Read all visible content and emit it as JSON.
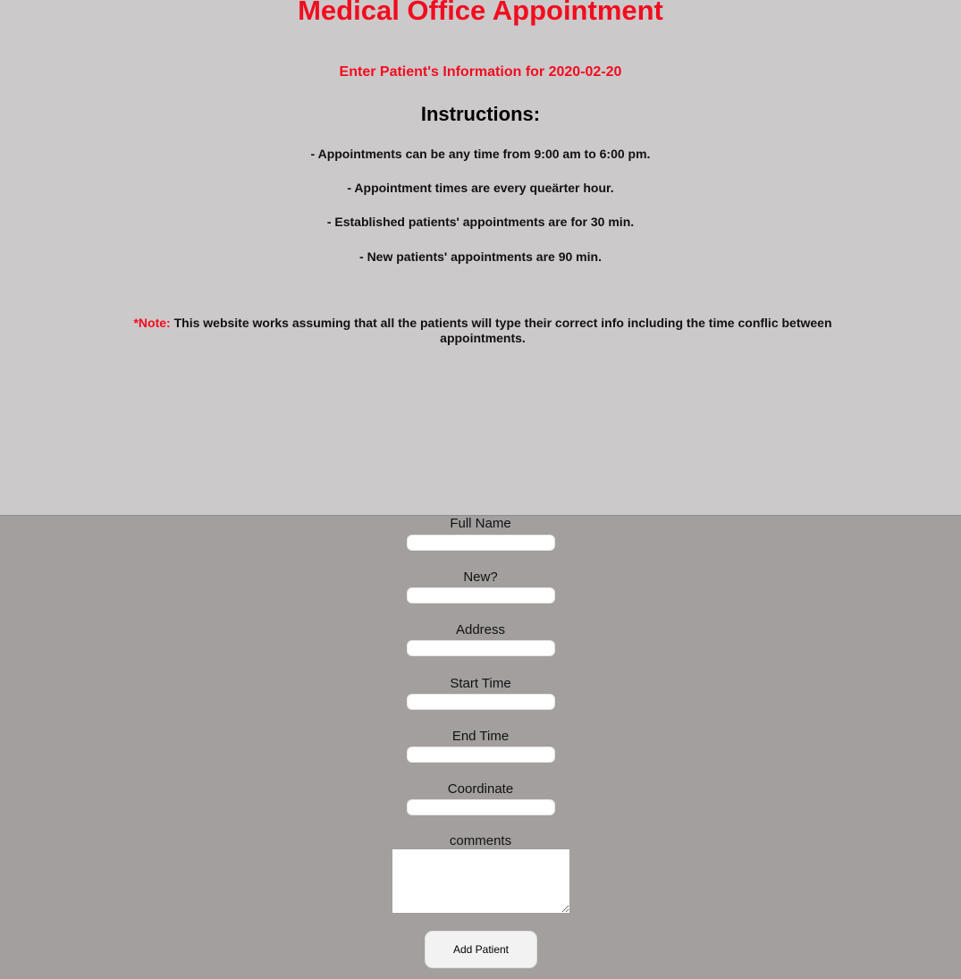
{
  "header": {
    "title": "Medical Office Appointment",
    "subtitle": "Enter Patient's Information for 2020-02-20",
    "instructions_heading": "Instructions:",
    "instructions": [
      "- Appointments can be any time from 9:00 am to 6:00 pm.",
      "- Appointment times are every queärter hour.",
      "- Established patients' appointments are for 30 min.",
      "- New patients' appointments are 90 min."
    ],
    "note_label": "*Note:",
    "note_text": " This website works assuming that all the patients will type their correct info including the time conflic between appointments."
  },
  "form": {
    "full_name": {
      "label": "Full Name",
      "value": ""
    },
    "new": {
      "label": "New?",
      "value": ""
    },
    "address": {
      "label": "Address",
      "value": ""
    },
    "start_time": {
      "label": "Start Time",
      "value": ""
    },
    "end_time": {
      "label": "End Time",
      "value": ""
    },
    "coordinate": {
      "label": "Coordinate",
      "value": ""
    },
    "comments": {
      "label": "comments",
      "value": ""
    },
    "submit_label": "Add Patient"
  },
  "colors": {
    "accent": "#f20c1f",
    "top_background": "#ccc9ca",
    "bottom_background": "#a39f9f"
  }
}
